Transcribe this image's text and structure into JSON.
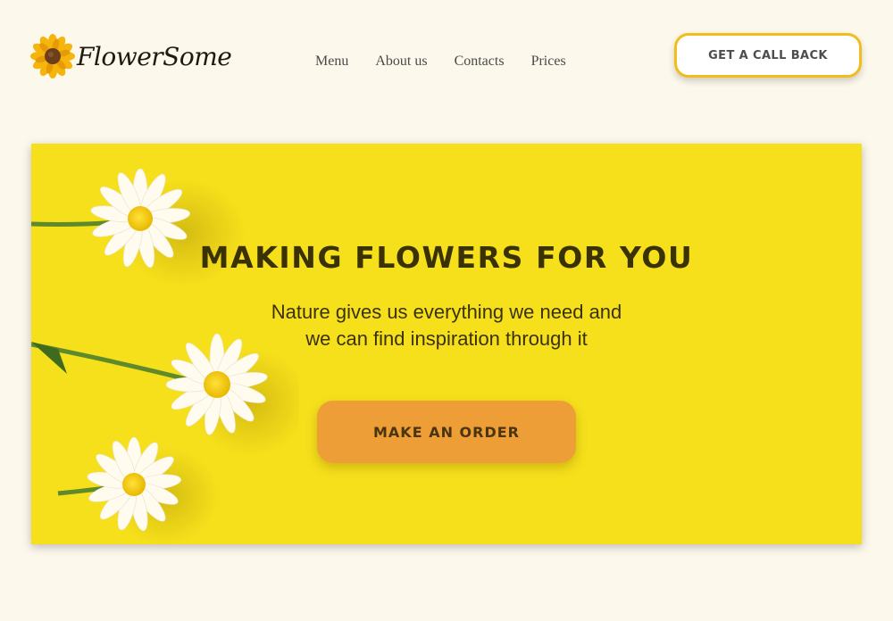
{
  "header": {
    "logo_text": "FlowerSome",
    "logo_icon": "sunflower-icon",
    "nav": [
      {
        "label": "Menu"
      },
      {
        "label": "About us"
      },
      {
        "label": "Contacts"
      },
      {
        "label": "Prices"
      }
    ],
    "callback_label": "GET A CALL BACK"
  },
  "hero": {
    "title": "MAKING FLOWERS FOR YOU",
    "subtitle": "Nature gives us everything we need and we can find inspiration through it",
    "order_label": "MAKE AN ORDER",
    "image": "daisies-image"
  },
  "colors": {
    "page_background": "#fdf8ec",
    "hero_background": "#f6e01b",
    "accent_orange": "#ee9e36",
    "button_border": "#f1bd1e",
    "text_dark": "#3b3204"
  }
}
